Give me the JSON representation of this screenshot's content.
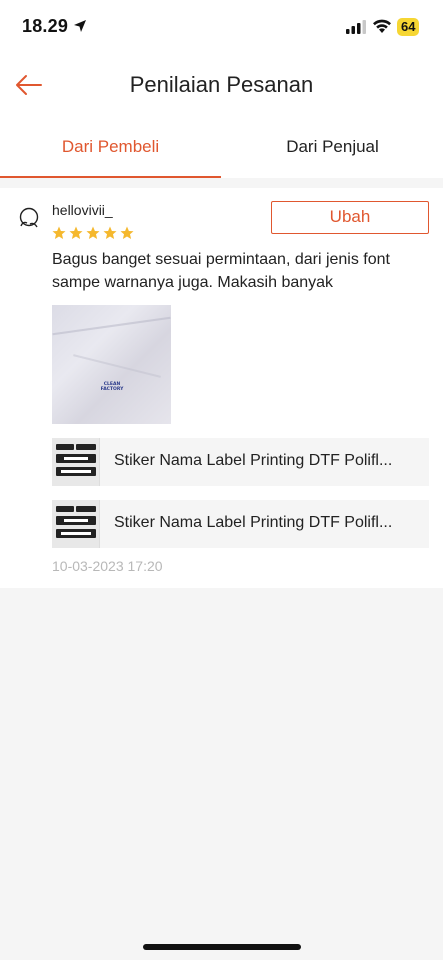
{
  "status_bar": {
    "time": "18.29",
    "battery": "64",
    "icons": [
      "location-arrow-icon",
      "signal-icon",
      "wifi-icon",
      "battery-icon"
    ]
  },
  "header": {
    "title": "Penilaian Pesanan",
    "back_icon": "arrow-left-icon"
  },
  "tabs": [
    {
      "label": "Dari Pembeli",
      "active": true
    },
    {
      "label": "Dari Penjual",
      "active": false
    }
  ],
  "review": {
    "username": "hellovivii_",
    "rating": 5,
    "edit_label": "Ubah",
    "text": "Bagus banget sesuai permintaan, dari jenis font sampe warnanya juga. Makasih banyak",
    "photo_caption": "CLEAN FACTORY",
    "products": [
      {
        "name": "Stiker Nama Label Printing DTF Polifl..."
      },
      {
        "name": "Stiker Nama Label Printing DTF Polifl..."
      }
    ],
    "timestamp": "10-03-2023 17:20"
  },
  "colors": {
    "accent": "#e0572f",
    "star": "#f5b82e",
    "battery": "#f6d633"
  }
}
